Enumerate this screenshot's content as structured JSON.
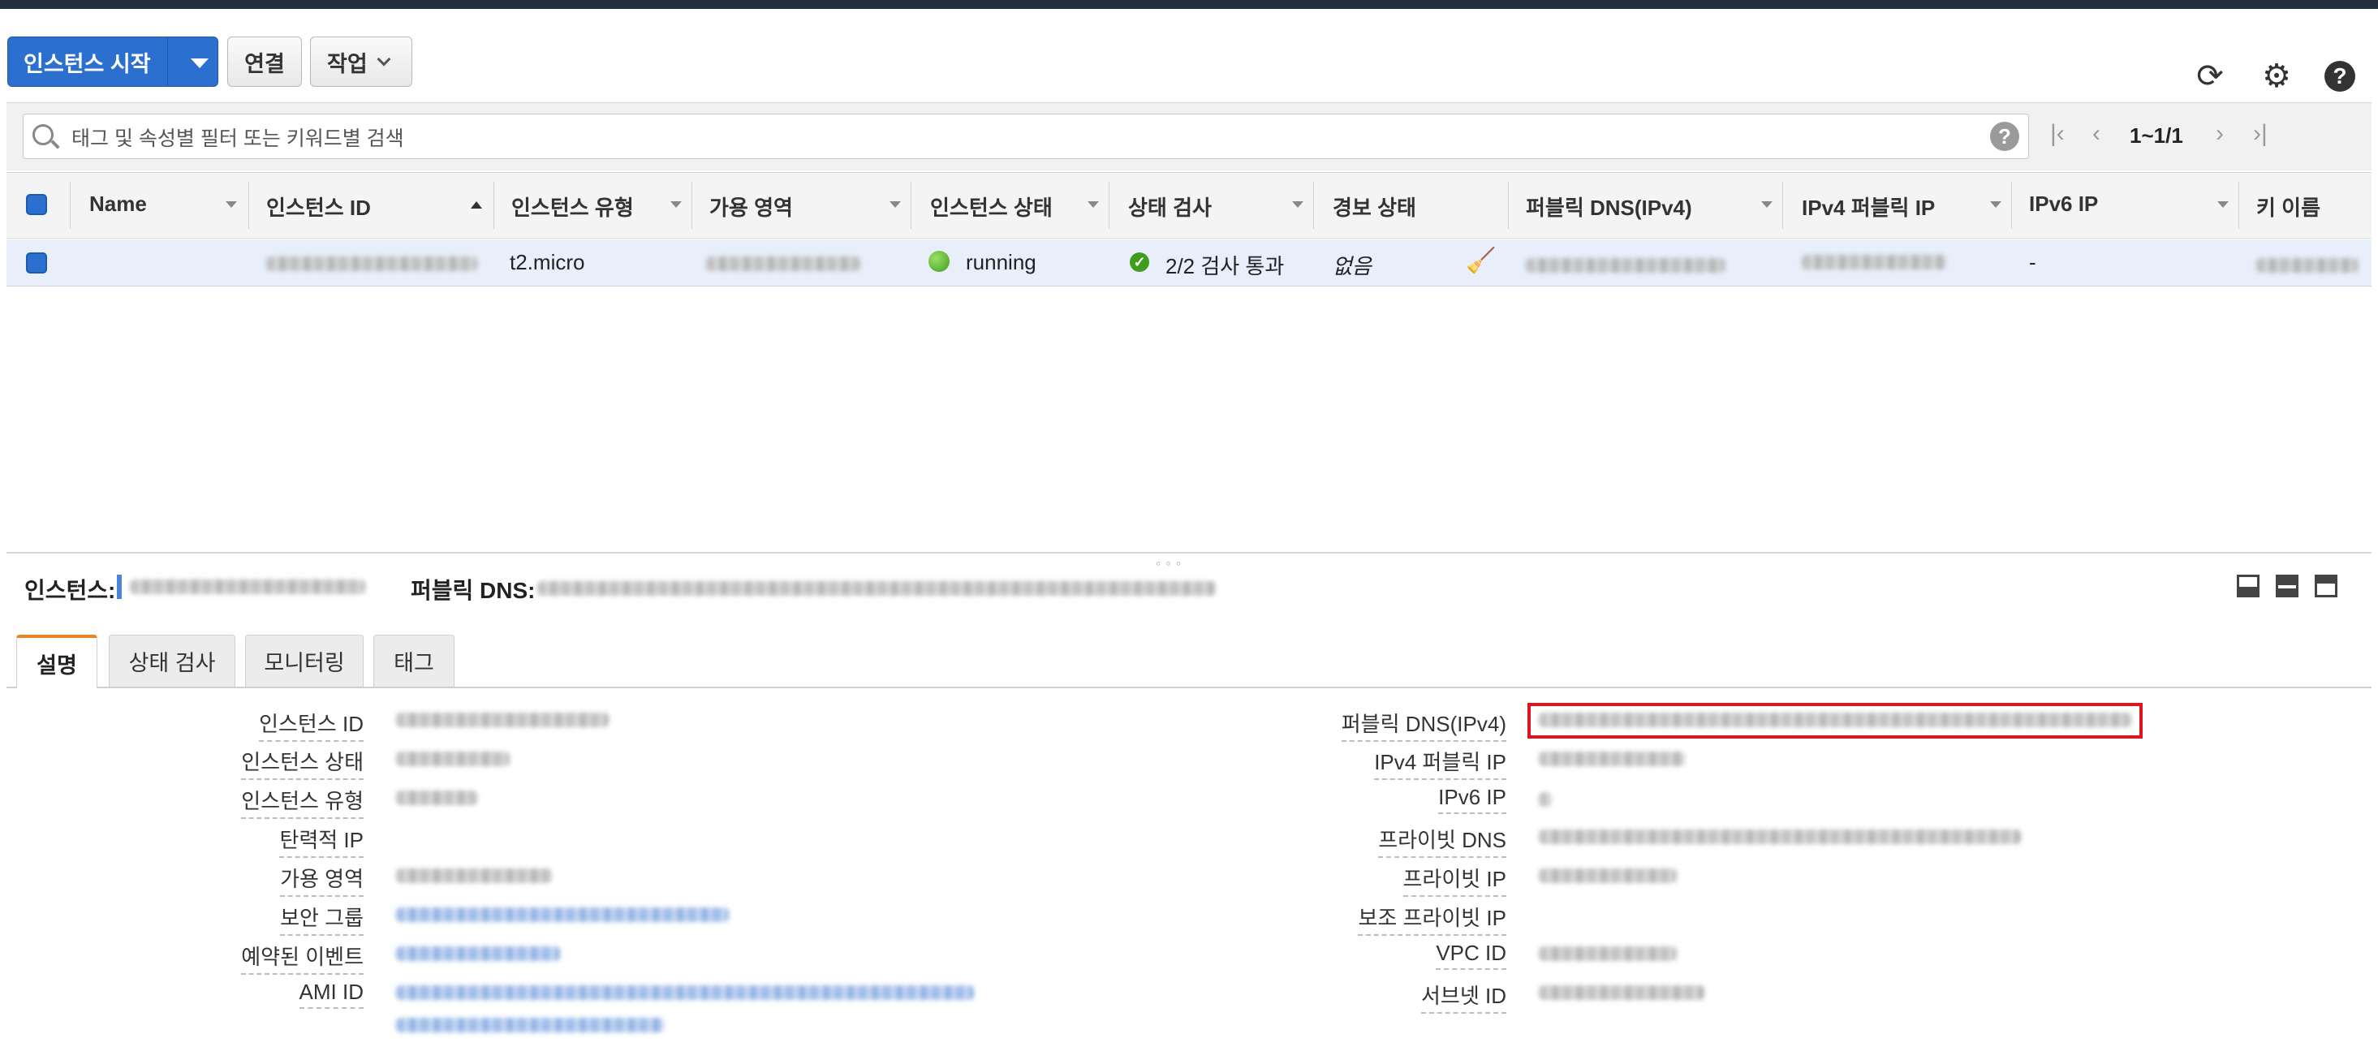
{
  "toolbar": {
    "launch_label": "인스턴스 시작",
    "connect_label": "연결",
    "actions_label": "작업"
  },
  "search": {
    "placeholder": "태그 및 속성별 필터 또는 키워드별 검색",
    "help": "?"
  },
  "pagination": {
    "range": "1~1/1"
  },
  "table": {
    "columns": [
      "Name",
      "인스턴스 ID",
      "인스턴스 유형",
      "가용 영역",
      "인스턴스 상태",
      "상태 검사",
      "경보 상태",
      "퍼블릭 DNS(IPv4)",
      "IPv4 퍼블릭 IP",
      "IPv6 IP",
      "키 이름"
    ],
    "rows": [
      {
        "instance_type": "t2.micro",
        "state": "running",
        "status_check": "2/2 검사 통과",
        "alarm": "없음",
        "ipv6": "-"
      }
    ]
  },
  "detail": {
    "instance_label": "인스턴스:",
    "public_dns_label": "퍼블릭 DNS:",
    "tabs": [
      "설명",
      "상태 검사",
      "모니터링",
      "태그"
    ],
    "left_fields": [
      "인스턴스 ID",
      "인스턴스 상태",
      "인스턴스 유형",
      "탄력적 IP",
      "가용 영역",
      "보안 그룹",
      "예약된 이벤트",
      "AMI ID"
    ],
    "right_fields": [
      "퍼블릭 DNS(IPv4)",
      "IPv4 퍼블릭 IP",
      "IPv6 IP",
      "프라이빗 DNS",
      "프라이빗 IP",
      "보조 프라이빗 IP",
      "VPC ID",
      "서브넷 ID"
    ]
  },
  "colors": {
    "primary": "#2b6fcf",
    "running": "#3f9d1c",
    "highlight": "#e0141e",
    "tab_accent": "#e8862a"
  }
}
